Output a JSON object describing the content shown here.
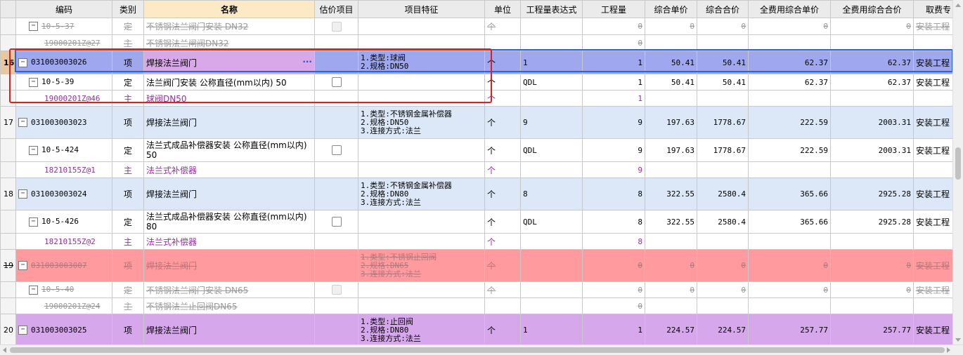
{
  "headers": {
    "code": "编码",
    "category": "类别",
    "name": "名称",
    "estimate": "估价项目",
    "feature": "项目特征",
    "unit": "单位",
    "expr": "工程量表达式",
    "qty": "工程量",
    "unit_price": "综合单价",
    "total_price": "综合合价",
    "full_unit_price": "全费用综合单价",
    "full_total_price": "全费用综合合价",
    "fee": "取费专"
  },
  "rows": [
    {
      "code": "10-5-37",
      "cat": "定",
      "name": "不锈钢法兰阀门安装 DN32",
      "unit": "个",
      "qty": "0",
      "up": "0",
      "tp": "0",
      "fup": "0",
      "ftp": "0",
      "fee": "安装工程"
    },
    {
      "code": "19000201Z@27",
      "cat": "主",
      "name": "不锈钢法兰闸阀DN32",
      "qty": "0"
    },
    {
      "rownum": "16",
      "code": "031003003026",
      "cat": "项",
      "name": "焊接法兰阀门",
      "feature": "1.类型:球阀\n2.规格:DN50",
      "unit": "个",
      "expr": "1",
      "qty": "1",
      "up": "50.41",
      "tp": "50.41",
      "fup": "62.37",
      "ftp": "62.37",
      "fee": "安装工程",
      "more": "···"
    },
    {
      "code": "10-5-39",
      "cat": "定",
      "name": "法兰阀门安装 公称直径(mm以内) 50",
      "unit": "个",
      "expr": "QDL",
      "qty": "1",
      "up": "50.41",
      "tp": "50.41",
      "fup": "62.37",
      "ftp": "62.37",
      "fee": "安装工程"
    },
    {
      "code": "19000201Z@46",
      "cat": "主",
      "name": "球阀DN50",
      "unit": "个",
      "qty": "1"
    },
    {
      "rownum": "17",
      "code": "031003003023",
      "cat": "项",
      "name": "焊接法兰阀门",
      "feature": "1.类型:不锈钢金属补偿器\n2.规格:DN50\n3.连接方式:法兰",
      "unit": "个",
      "expr": "9",
      "qty": "9",
      "up": "197.63",
      "tp": "1778.67",
      "fup": "222.59",
      "ftp": "2003.31",
      "fee": "安装工程"
    },
    {
      "code": "10-5-424",
      "cat": "定",
      "name": "法兰式成品补偿器安装 公称直径(mm以内) 50",
      "unit": "个",
      "expr": "QDL",
      "qty": "9",
      "up": "197.63",
      "tp": "1778.67",
      "fup": "222.59",
      "ftp": "2003.31",
      "fee": "安装工程"
    },
    {
      "code": "18210155Z@1",
      "cat": "主",
      "name": "法兰式补偿器",
      "unit": "个",
      "qty": "9"
    },
    {
      "rownum": "18",
      "code": "031003003024",
      "cat": "项",
      "name": "焊接法兰阀门",
      "feature": "1.类型:不锈钢金属补偿器\n2.规格:DN80\n3.连接方式:法兰",
      "unit": "个",
      "expr": "8",
      "qty": "8",
      "up": "322.55",
      "tp": "2580.4",
      "fup": "365.66",
      "ftp": "2925.28",
      "fee": "安装工程"
    },
    {
      "code": "10-5-426",
      "cat": "定",
      "name": "法兰式成品补偿器安装 公称直径(mm以内) 80",
      "unit": "个",
      "expr": "QDL",
      "qty": "8",
      "up": "322.55",
      "tp": "2580.4",
      "fup": "365.66",
      "ftp": "2925.28",
      "fee": "安装工程"
    },
    {
      "code": "18210155Z@2",
      "cat": "主",
      "name": "法兰式补偿器",
      "unit": "个",
      "qty": "8"
    },
    {
      "rownum": "19",
      "code": "031003003007",
      "cat": "项",
      "name": "焊接法兰阀门",
      "feature": "1.类型:不锈钢止回阀\n2.规格:DN65\n3.连接方式:法兰",
      "unit": "个",
      "qty": "0",
      "up": "0",
      "tp": "0",
      "fup": "0",
      "ftp": "0",
      "fee": "安装工程"
    },
    {
      "code": "10-5-40",
      "cat": "定",
      "name": "不锈钢法兰阀门安装 DN65",
      "unit": "个",
      "qty": "0",
      "up": "0",
      "tp": "0",
      "fup": "0",
      "ftp": "0",
      "fee": "安装工程"
    },
    {
      "code": "19000201Z@24",
      "cat": "主",
      "name": "不锈钢法兰止回阀DN65",
      "qty": "0"
    },
    {
      "rownum": "20",
      "code": "031003003025",
      "cat": "项",
      "name": "焊接法兰阀门",
      "feature": "1.类型:止回阀\n2.规格:DN80\n3.连接方式:法兰",
      "unit": "个",
      "expr": "1",
      "qty": "1",
      "up": "224.57",
      "tp": "224.57",
      "fup": "257.77",
      "ftp": "257.77",
      "fee": "安装工程"
    }
  ]
}
